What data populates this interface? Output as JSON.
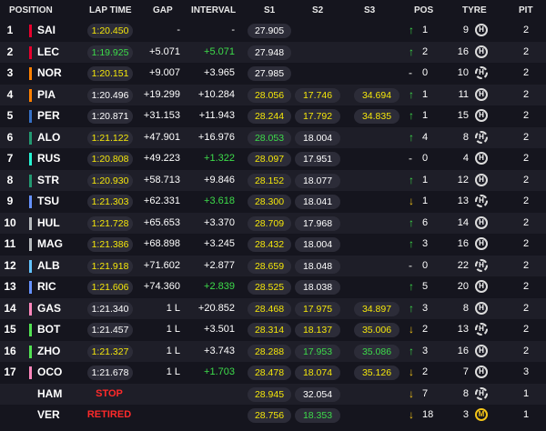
{
  "headers": {
    "position": "POSITION",
    "lap_time": "LAP TIME",
    "gap": "GAP",
    "interval": "INTERVAL",
    "s1": "S1",
    "s2": "S2",
    "s3": "S3",
    "pos": "POS",
    "tyre": "TYRE",
    "pit": "PIT"
  },
  "colors": {
    "background": "#15151e",
    "row_alt": "#1e1e28",
    "yellow_time": "#f5e70a",
    "green_time": "#3ddc4a",
    "status_red": "#ff2a2a"
  },
  "rows": [
    {
      "pos": "1",
      "code": "SAI",
      "team_color": "#e8002d",
      "lap": "1:20.450",
      "lap_c": "yellow",
      "gap": "-",
      "interval": "-",
      "int_c": "white",
      "s1": "27.905",
      "s2": "",
      "s3": "",
      "arrow": "up",
      "poschg": "1",
      "tyre": "9",
      "compound": "H",
      "pit": "2"
    },
    {
      "pos": "2",
      "code": "LEC",
      "team_color": "#e8002d",
      "lap": "1:19.925",
      "lap_c": "green",
      "gap": "+5.071",
      "interval": "+5.071",
      "int_c": "green",
      "s1": "27.948",
      "s2": "",
      "s3": "",
      "arrow": "up",
      "poschg": "2",
      "tyre": "16",
      "compound": "H",
      "pit": "2"
    },
    {
      "pos": "3",
      "code": "NOR",
      "team_color": "#ff8000",
      "lap": "1:20.151",
      "lap_c": "yellow",
      "gap": "+9.007",
      "interval": "+3.965",
      "int_c": "white",
      "s1": "27.985",
      "s2": "",
      "s3": "",
      "arrow": "same",
      "poschg": "0",
      "tyre": "10",
      "compound": "H",
      "pit": "2"
    },
    {
      "pos": "4",
      "code": "PIA",
      "team_color": "#ff8000",
      "lap": "1:20.496",
      "lap_c": "white",
      "gap": "+19.299",
      "interval": "+10.284",
      "int_c": "white",
      "s1": "28.056",
      "s1_c": "yellow",
      "s2": "17.746",
      "s2_c": "yellow",
      "s3": "34.694",
      "s3_c": "yellow",
      "arrow": "up",
      "poschg": "1",
      "tyre": "11",
      "compound": "H",
      "pit": "2"
    },
    {
      "pos": "5",
      "code": "PER",
      "team_color": "#3671c6",
      "lap": "1:20.871",
      "lap_c": "white",
      "gap": "+31.153",
      "interval": "+11.943",
      "int_c": "white",
      "s1": "28.244",
      "s1_c": "yellow",
      "s2": "17.792",
      "s2_c": "yellow",
      "s3": "34.835",
      "s3_c": "yellow",
      "arrow": "up",
      "poschg": "1",
      "tyre": "15",
      "compound": "H",
      "pit": "2"
    },
    {
      "pos": "6",
      "code": "ALO",
      "team_color": "#229971",
      "lap": "1:21.122",
      "lap_c": "yellow",
      "gap": "+47.901",
      "interval": "+16.976",
      "int_c": "white",
      "s1": "28.053",
      "s1_c": "green",
      "s2": "18.004",
      "s2_c": "white",
      "s3": "",
      "arrow": "up",
      "poschg": "4",
      "tyre": "8",
      "compound": "H",
      "pit": "2"
    },
    {
      "pos": "7",
      "code": "RUS",
      "team_color": "#27f4d2",
      "lap": "1:20.808",
      "lap_c": "yellow",
      "gap": "+49.223",
      "interval": "+1.322",
      "int_c": "green",
      "s1": "28.097",
      "s1_c": "yellow",
      "s2": "17.951",
      "s2_c": "white",
      "s3": "",
      "arrow": "same",
      "poschg": "0",
      "tyre": "4",
      "compound": "H",
      "pit": "2"
    },
    {
      "pos": "8",
      "code": "STR",
      "team_color": "#229971",
      "lap": "1:20.930",
      "lap_c": "yellow",
      "gap": "+58.713",
      "interval": "+9.846",
      "int_c": "white",
      "s1": "28.152",
      "s1_c": "yellow",
      "s2": "18.077",
      "s2_c": "white",
      "s3": "",
      "arrow": "up",
      "poschg": "1",
      "tyre": "12",
      "compound": "H",
      "pit": "2"
    },
    {
      "pos": "9",
      "code": "TSU",
      "team_color": "#6692ff",
      "lap": "1:21.303",
      "lap_c": "yellow",
      "gap": "+62.331",
      "interval": "+3.618",
      "int_c": "green",
      "s1": "28.300",
      "s1_c": "yellow",
      "s2": "18.041",
      "s2_c": "white",
      "s3": "",
      "arrow": "down",
      "poschg": "1",
      "tyre": "13",
      "compound": "H",
      "pit": "2"
    },
    {
      "pos": "10",
      "code": "HUL",
      "team_color": "#b6babd",
      "lap": "1:21.728",
      "lap_c": "yellow",
      "gap": "+65.653",
      "interval": "+3.370",
      "int_c": "white",
      "s1": "28.709",
      "s1_c": "yellow",
      "s2": "17.968",
      "s2_c": "white",
      "s3": "",
      "arrow": "up",
      "poschg": "6",
      "tyre": "14",
      "compound": "H",
      "pit": "2"
    },
    {
      "pos": "11",
      "code": "MAG",
      "team_color": "#b6babd",
      "lap": "1:21.386",
      "lap_c": "yellow",
      "gap": "+68.898",
      "interval": "+3.245",
      "int_c": "white",
      "s1": "28.432",
      "s1_c": "yellow",
      "s2": "18.004",
      "s2_c": "white",
      "s3": "",
      "arrow": "up",
      "poschg": "3",
      "tyre": "16",
      "compound": "H",
      "pit": "2"
    },
    {
      "pos": "12",
      "code": "ALB",
      "team_color": "#64c4ff",
      "lap": "1:21.918",
      "lap_c": "yellow",
      "gap": "+71.602",
      "interval": "+2.877",
      "int_c": "white",
      "s1": "28.659",
      "s1_c": "yellow",
      "s2": "18.048",
      "s2_c": "white",
      "s3": "",
      "arrow": "same",
      "poschg": "0",
      "tyre": "22",
      "compound": "H",
      "pit": "2"
    },
    {
      "pos": "13",
      "code": "RIC",
      "team_color": "#6692ff",
      "lap": "1:21.606",
      "lap_c": "yellow",
      "gap": "+74.360",
      "interval": "+2.839",
      "int_c": "green",
      "s1": "28.525",
      "s1_c": "yellow",
      "s2": "18.038",
      "s2_c": "white",
      "s3": "",
      "arrow": "up",
      "poschg": "5",
      "tyre": "20",
      "compound": "H",
      "pit": "2"
    },
    {
      "pos": "14",
      "code": "GAS",
      "team_color": "#ff87bc",
      "lap": "1:21.340",
      "lap_c": "white",
      "gap": "1 L",
      "interval": "+20.852",
      "int_c": "white",
      "s1": "28.468",
      "s1_c": "yellow",
      "s2": "17.975",
      "s2_c": "yellow",
      "s3": "34.897",
      "s3_c": "yellow",
      "arrow": "up",
      "poschg": "3",
      "tyre": "8",
      "compound": "H",
      "pit": "2"
    },
    {
      "pos": "15",
      "code": "BOT",
      "team_color": "#52e252",
      "lap": "1:21.457",
      "lap_c": "white",
      "gap": "1 L",
      "interval": "+3.501",
      "int_c": "white",
      "s1": "28.314",
      "s1_c": "yellow",
      "s2": "18.137",
      "s2_c": "yellow",
      "s3": "35.006",
      "s3_c": "yellow",
      "arrow": "down",
      "poschg": "2",
      "tyre": "13",
      "compound": "H",
      "pit": "2"
    },
    {
      "pos": "16",
      "code": "ZHO",
      "team_color": "#52e252",
      "lap": "1:21.327",
      "lap_c": "yellow",
      "gap": "1 L",
      "interval": "+3.743",
      "int_c": "white",
      "s1": "28.288",
      "s1_c": "yellow",
      "s2": "17.953",
      "s2_c": "green",
      "s3": "35.086",
      "s3_c": "green",
      "arrow": "up",
      "poschg": "3",
      "tyre": "16",
      "compound": "H",
      "pit": "2"
    },
    {
      "pos": "17",
      "code": "OCO",
      "team_color": "#ff87bc",
      "lap": "1:21.678",
      "lap_c": "white",
      "gap": "1 L",
      "interval": "+1.703",
      "int_c": "green",
      "s1": "28.478",
      "s1_c": "yellow",
      "s2": "18.074",
      "s2_c": "yellow",
      "s3": "35.126",
      "s3_c": "yellow",
      "arrow": "down",
      "poschg": "2",
      "tyre": "7",
      "compound": "H",
      "pit": "3"
    },
    {
      "pos": "",
      "code": "HAM",
      "team_color": "",
      "status": "STOP",
      "s1": "28.945",
      "s1_c": "yellow",
      "s2": "32.054",
      "s2_c": "white",
      "s3": "",
      "arrow": "down",
      "poschg": "7",
      "tyre": "8",
      "compound": "H",
      "pit": "1"
    },
    {
      "pos": "",
      "code": "VER",
      "team_color": "",
      "status": "RETIRED",
      "s1": "28.756",
      "s1_c": "yellow",
      "s2": "18.353",
      "s2_c": "green",
      "s3": "",
      "arrow": "down",
      "poschg": "18",
      "tyre": "3",
      "compound": "M",
      "pit": "1"
    }
  ]
}
